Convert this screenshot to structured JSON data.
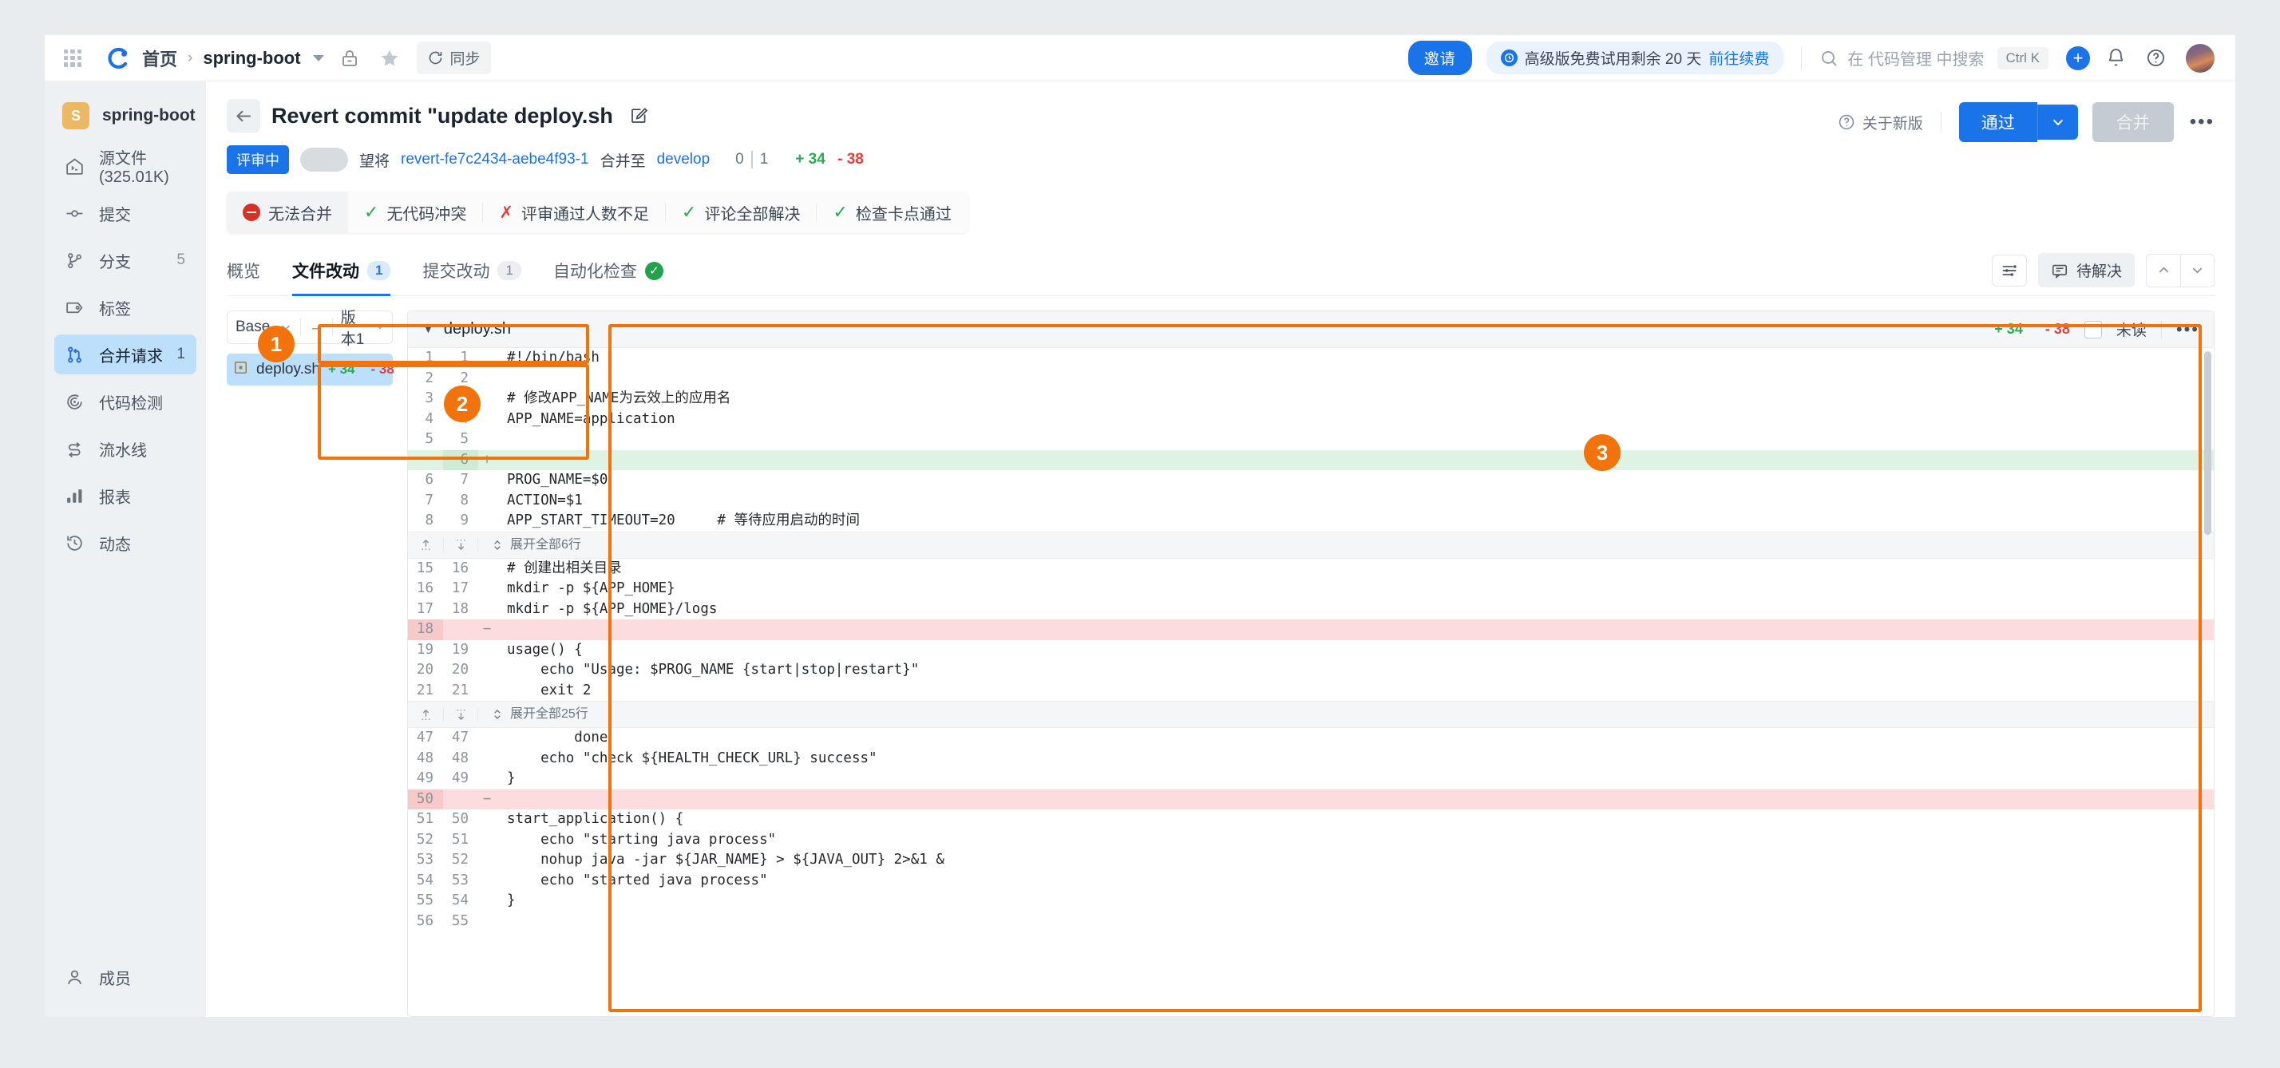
{
  "topbar": {
    "apps_icon": "grid-apps-icon",
    "logo": "codeup-logo-icon",
    "breadcrumb_home": "首页",
    "breadcrumb_sep": "›",
    "breadcrumb_project": "spring-boot",
    "lock_icon": "lock-icon",
    "star_icon": "star-icon",
    "sync_label": "同步",
    "invite_label": "邀请",
    "trial_text": "高级版免费试用剩余 20 天",
    "trial_link": "前往续费",
    "search_placeholder": "在 代码管理 中搜索",
    "shortcut": "Ctrl K",
    "plus_icon": "plus-icon",
    "bell_icon": "notification-bell-icon",
    "help_icon": "help-circle-icon",
    "avatar": "user-avatar"
  },
  "sidebar": {
    "project_initial": "S",
    "project_name": "spring-boot",
    "items": [
      {
        "label": "源文件(325.01K)",
        "icon": "source-files-icon",
        "count": "",
        "active": false
      },
      {
        "label": "提交",
        "icon": "commit-icon",
        "count": "",
        "active": false
      },
      {
        "label": "分支",
        "icon": "branch-icon",
        "count": "5",
        "active": false
      },
      {
        "label": "标签",
        "icon": "tag-icon",
        "count": "",
        "active": false
      },
      {
        "label": "合并请求",
        "icon": "merge-request-icon",
        "count": "1",
        "active": true
      },
      {
        "label": "代码检测",
        "icon": "code-scan-icon",
        "count": "",
        "active": false
      },
      {
        "label": "流水线",
        "icon": "pipeline-icon",
        "count": "",
        "active": false
      },
      {
        "label": "报表",
        "icon": "report-chart-icon",
        "count": "",
        "active": false
      },
      {
        "label": "动态",
        "icon": "activity-history-icon",
        "count": "",
        "active": false
      }
    ],
    "bottom_item": {
      "label": "成员",
      "icon": "member-user-icon"
    }
  },
  "mr": {
    "back_icon": "back-arrow-icon",
    "title": "Revert commit \"update deploy.sh",
    "edit_icon": "edit-pencil-icon",
    "status_badge": "评审中",
    "sub_prefix": "望将",
    "source_branch": "revert-fe7c2434-aebe4f93-1",
    "sub_middle": "合并至",
    "target_branch": "develop",
    "count_left": "0",
    "count_right": "1",
    "additions": "+ 34",
    "deletions": "- 38",
    "about_label": "关于新版",
    "about_icon": "help-circle-icon",
    "pass_label": "通过",
    "pass_caret_icon": "chevron-down-icon",
    "merge_label": "合并",
    "more_icon": "more-dots-icon"
  },
  "status_checks": {
    "primary": {
      "label": "无法合并",
      "icon": "error-circle-icon"
    },
    "items": [
      {
        "label": "无代码冲突",
        "icon": "check-icon",
        "state": "pass"
      },
      {
        "label": "评审通过人数不足",
        "icon": "cross-icon",
        "state": "fail"
      },
      {
        "label": "评论全部解决",
        "icon": "check-icon",
        "state": "pass"
      },
      {
        "label": "检查卡点通过",
        "icon": "check-icon",
        "state": "pass"
      }
    ]
  },
  "tabs": [
    {
      "label": "概览",
      "badge": "",
      "badge_type": "none",
      "active": false
    },
    {
      "label": "文件改动",
      "badge": "1",
      "badge_type": "blue",
      "active": true
    },
    {
      "label": "提交改动",
      "badge": "1",
      "badge_type": "grey",
      "active": false
    },
    {
      "label": "自动化检查",
      "badge": "",
      "badge_type": "ok-icon",
      "active": false
    }
  ],
  "tabs_right": {
    "settings_icon": "diff-settings-icon",
    "resolve_label": "待解决",
    "resolve_icon": "comment-icon",
    "prev_icon": "chevron-up-icon",
    "next_icon": "chevron-down-icon"
  },
  "file_panel": {
    "base_label": "Base",
    "arrow": "→",
    "version_label": "版本1",
    "caret_icon": "chevron-down-icon",
    "files": [
      {
        "name": "deploy.sh",
        "icon": "file-icon",
        "additions": "+ 34",
        "deletions": "- 38",
        "selected": true
      }
    ]
  },
  "diff": {
    "file_name": "deploy.sh",
    "collapse_icon": "triangle-down-icon",
    "additions": "+ 34",
    "deletions": "- 38",
    "unread_label": "未读",
    "more_icon": "more-dots-icon",
    "rows": [
      {
        "type": "ctx",
        "old": "1",
        "new": "1",
        "sign": "",
        "code": "#!/bin/bash",
        "cls": "c-str"
      },
      {
        "type": "ctx",
        "old": "2",
        "new": "2",
        "sign": "",
        "code": ""
      },
      {
        "type": "ctx",
        "old": "3",
        "new": "3",
        "sign": "",
        "code": "# 修改APP_NAME为云效上的应用名",
        "cls": "c-cmt"
      },
      {
        "type": "ctx",
        "old": "4",
        "new": "4",
        "sign": "",
        "code": "APP_NAME=application"
      },
      {
        "type": "ctx",
        "old": "5",
        "new": "5",
        "sign": "",
        "code": ""
      },
      {
        "type": "add",
        "old": "",
        "new": "6",
        "sign": "+",
        "code": ""
      },
      {
        "type": "ctx",
        "old": "6",
        "new": "7",
        "sign": "",
        "code": "PROG_NAME=$0"
      },
      {
        "type": "ctx",
        "old": "7",
        "new": "8",
        "sign": "",
        "code": "ACTION=$1"
      },
      {
        "type": "ctx",
        "old": "8",
        "new": "9",
        "sign": "",
        "code": "APP_START_TIMEOUT=20     # 等待应用启动的时间"
      },
      {
        "type": "exp",
        "label": "展开全部6行"
      },
      {
        "type": "ctx",
        "old": "15",
        "new": "16",
        "sign": "",
        "code": "# 创建出相关目录",
        "cls": "c-cmt"
      },
      {
        "type": "ctx",
        "old": "16",
        "new": "17",
        "sign": "",
        "code": "mkdir -p ${APP_HOME}"
      },
      {
        "type": "ctx",
        "old": "17",
        "new": "18",
        "sign": "",
        "code": "mkdir -p ${APP_HOME}/logs"
      },
      {
        "type": "del",
        "old": "18",
        "new": "",
        "sign": "−",
        "code": ""
      },
      {
        "type": "ctx",
        "old": "19",
        "new": "19",
        "sign": "",
        "code": "usage() {"
      },
      {
        "type": "ctx",
        "old": "20",
        "new": "20",
        "sign": "",
        "code": "    echo \"Usage: $PROG_NAME {start|stop|restart}\""
      },
      {
        "type": "ctx",
        "old": "21",
        "new": "21",
        "sign": "",
        "code": "    exit 2"
      },
      {
        "type": "exp",
        "label": "展开全部25行"
      },
      {
        "type": "ctx",
        "old": "47",
        "new": "47",
        "sign": "",
        "code": "        done"
      },
      {
        "type": "ctx",
        "old": "48",
        "new": "48",
        "sign": "",
        "code": "    echo \"check ${HEALTH_CHECK_URL} success\""
      },
      {
        "type": "ctx",
        "old": "49",
        "new": "49",
        "sign": "",
        "code": "}"
      },
      {
        "type": "del",
        "old": "50",
        "new": "",
        "sign": "−",
        "code": ""
      },
      {
        "type": "ctx",
        "old": "51",
        "new": "50",
        "sign": "",
        "code": "start_application() {"
      },
      {
        "type": "ctx",
        "old": "52",
        "new": "51",
        "sign": "",
        "code": "    echo \"starting java process\""
      },
      {
        "type": "ctx",
        "old": "53",
        "new": "52",
        "sign": "",
        "code": "    nohup java -jar ${JAR_NAME} > ${JAVA_OUT} 2>&1 &"
      },
      {
        "type": "ctx",
        "old": "54",
        "new": "53",
        "sign": "",
        "code": "    echo \"started java process\""
      },
      {
        "type": "ctx",
        "old": "55",
        "new": "54",
        "sign": "",
        "code": "}"
      },
      {
        "type": "ctx",
        "old": "56",
        "new": "55",
        "sign": "",
        "code": ""
      }
    ],
    "expander_up_icon": "expand-up-icon",
    "expander_down_icon": "expand-down-icon",
    "expander_all_icon": "expand-all-icon"
  },
  "annotations": [
    {
      "number": "1"
    },
    {
      "number": "2"
    },
    {
      "number": "3"
    }
  ],
  "colors": {
    "accent": "#1a73e8",
    "annotation": "#f2730c",
    "add": "#2aab4c",
    "del": "#e0413a"
  }
}
